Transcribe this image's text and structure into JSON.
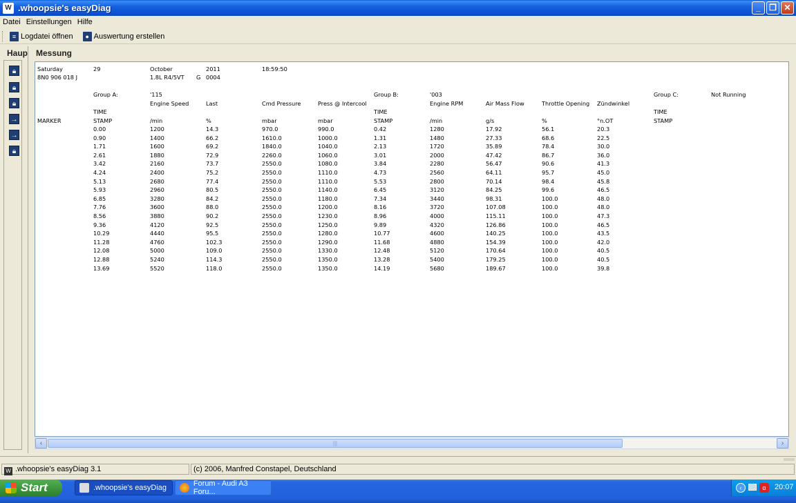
{
  "window": {
    "title": ".whoopsie's easyDiag"
  },
  "menu": [
    "Datei",
    "Einstellungen",
    "Hilfe"
  ],
  "toolbar": {
    "open_log": "Logdatei öffnen",
    "create_eval": "Auswertung erstellen"
  },
  "side": {
    "title": "Haupt"
  },
  "main": {
    "title": "Messung"
  },
  "meta": {
    "day": "Saturday",
    "date": "29",
    "month": "October",
    "year": "2011",
    "time": "18:59:50",
    "part": "8N0 906 018 J",
    "engine": "1.8L R4/5VT",
    "g": "G",
    "code": "0004"
  },
  "groups": {
    "a_label": "Group A:",
    "a_id": "'115",
    "b_label": "Group B:",
    "b_id": "'003",
    "c_label": "Group C:",
    "c_status": "Not Running"
  },
  "row_label": {
    "marker": "MARKER"
  },
  "columns": [
    {
      "name": "",
      "sub": "TIME",
      "unit": "STAMP"
    },
    {
      "name": "Engine Speed",
      "sub": "",
      "unit": "/min"
    },
    {
      "name": "Last",
      "sub": "",
      "unit": "%"
    },
    {
      "name": "Cmd Pressure",
      "sub": "",
      "unit": "mbar"
    },
    {
      "name": "Press @ Intercool",
      "sub": "",
      "unit": "mbar"
    },
    {
      "name": "",
      "sub": "TIME",
      "unit": "STAMP"
    },
    {
      "name": "Engine RPM",
      "sub": "",
      "unit": "/min"
    },
    {
      "name": "Air Mass Flow",
      "sub": "",
      "unit": "g/s"
    },
    {
      "name": "Throttle Opening",
      "sub": "",
      "unit": "%"
    },
    {
      "name": "Zündwinkel",
      "sub": "",
      "unit": "°n.OT"
    },
    {
      "name": "",
      "sub": "TIME",
      "unit": "STAMP"
    }
  ],
  "rows": [
    [
      "0.00",
      "1200",
      "14.3",
      "970.0",
      "990.0",
      "0.42",
      "1280",
      "17.92",
      "56.1",
      "20.3"
    ],
    [
      "0.90",
      "1400",
      "66.2",
      "1610.0",
      "1000.0",
      "1.31",
      "1480",
      "27.33",
      "68.6",
      "22.5"
    ],
    [
      "1.71",
      "1600",
      "69.2",
      "1840.0",
      "1040.0",
      "2.13",
      "1720",
      "35.89",
      "78.4",
      "30.0"
    ],
    [
      "2.61",
      "1880",
      "72.9",
      "2260.0",
      "1060.0",
      "3.01",
      "2000",
      "47.42",
      "86.7",
      "36.0"
    ],
    [
      "3.42",
      "2160",
      "73.7",
      "2550.0",
      "1080.0",
      "3.84",
      "2280",
      "56.47",
      "90.6",
      "41.3"
    ],
    [
      "4.24",
      "2400",
      "75.2",
      "2550.0",
      "1110.0",
      "4.73",
      "2560",
      "64.11",
      "95.7",
      "45.0"
    ],
    [
      "5.13",
      "2680",
      "77.4",
      "2550.0",
      "1110.0",
      "5.53",
      "2800",
      "70.14",
      "98.4",
      "45.8"
    ],
    [
      "5.93",
      "2960",
      "80.5",
      "2550.0",
      "1140.0",
      "6.45",
      "3120",
      "84.25",
      "99.6",
      "46.5"
    ],
    [
      "6.85",
      "3280",
      "84.2",
      "2550.0",
      "1180.0",
      "7.34",
      "3440",
      "98.31",
      "100.0",
      "48.0"
    ],
    [
      "7.76",
      "3600",
      "88.0",
      "2550.0",
      "1200.0",
      "8.16",
      "3720",
      "107.08",
      "100.0",
      "48.0"
    ],
    [
      "8.56",
      "3880",
      "90.2",
      "2550.0",
      "1230.0",
      "8.96",
      "4000",
      "115.11",
      "100.0",
      "47.3"
    ],
    [
      "9.36",
      "4120",
      "92.5",
      "2550.0",
      "1250.0",
      "9.89",
      "4320",
      "126.86",
      "100.0",
      "46.5"
    ],
    [
      "10.29",
      "4440",
      "95.5",
      "2550.0",
      "1280.0",
      "10.77",
      "4600",
      "140.25",
      "100.0",
      "43.5"
    ],
    [
      "11.28",
      "4760",
      "102.3",
      "2550.0",
      "1290.0",
      "11.68",
      "4880",
      "154.39",
      "100.0",
      "42.0"
    ],
    [
      "12.08",
      "5000",
      "109.0",
      "2550.0",
      "1330.0",
      "12.48",
      "5120",
      "170.64",
      "100.0",
      "40.5"
    ],
    [
      "12.88",
      "5240",
      "114.3",
      "2550.0",
      "1350.0",
      "13.28",
      "5400",
      "179.25",
      "100.0",
      "40.5"
    ],
    [
      "13.69",
      "5520",
      "118.0",
      "2550.0",
      "1350.0",
      "14.19",
      "5680",
      "189.67",
      "100.0",
      "39.8"
    ]
  ],
  "status": {
    "app": ".whoopsie's easyDiag 3.1",
    "copyright": "(c) 2006, Manfred Constapel, Deutschland"
  },
  "taskbar": {
    "start": "Start",
    "tasks": [
      ".whoopsie's easyDiag",
      "Forum - Audi A3 Foru..."
    ],
    "clock": "20:07"
  }
}
